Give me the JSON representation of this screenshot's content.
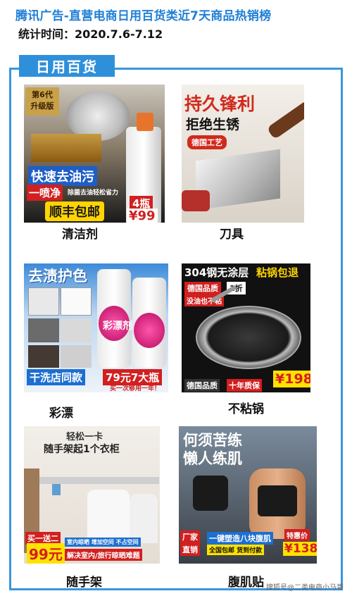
{
  "header": {
    "title": "腾讯广告-直营电商日用百货类近7天商品热销榜",
    "subtitle": "统计时间：2020.7.6-7.12"
  },
  "section": {
    "tab_label": "日用百货"
  },
  "products": [
    {
      "label": "清洁剂",
      "image_text": {
        "badge": "第6代\n升级版",
        "line1": "快速去油污",
        "line2": "一喷净",
        "line2b": "除菌去油轻松省力",
        "cta": "顺丰包邮",
        "qty": "4瓶",
        "price": "¥99"
      }
    },
    {
      "label": "刀具",
      "image_text": {
        "headline": "持久锋利",
        "sub": "拒绝生锈",
        "tag": "德国工艺"
      }
    },
    {
      "label": "彩漂",
      "image_text": {
        "headline": "去渍护色",
        "brand": "彩漂剂",
        "cta": "干洗店同款",
        "price": "79元7大瓶",
        "foot": "买一次够用一年！"
      }
    },
    {
      "label": "不粘锅",
      "image_text": {
        "top1": "304钢无涂层",
        "top2": "粘锅包退",
        "badge1": "德国品质",
        "badge2": "1折",
        "badge3": "没油也不粘",
        "foot1": "德国品质",
        "foot2": "十年质保",
        "price": "¥198"
      }
    },
    {
      "label": "随手架",
      "image_text": {
        "line1": "轻松一卡",
        "line2": "随手架起1个衣柜",
        "promo": "买一送二",
        "price": "99元",
        "strip1": "室内晾晒 增加空间 不占空间",
        "strip2": "解决室内/旅行晾晒难题"
      }
    },
    {
      "label": "腹肌贴",
      "image_text": {
        "headline1": "何须苦练",
        "headline2": "懒人练肌",
        "tag1": "厂家",
        "tag2": "直销",
        "strip1": "一键塑造八块腹肌",
        "strip2": "全国包邮 货到付款",
        "deal": "特惠价",
        "price": "¥138"
      }
    }
  ],
  "watermark": "搜狐号@二类电商小马哥",
  "colors": {
    "accent": "#2f90da",
    "title": "#1f7fd6",
    "price_red": "#e0201b"
  }
}
